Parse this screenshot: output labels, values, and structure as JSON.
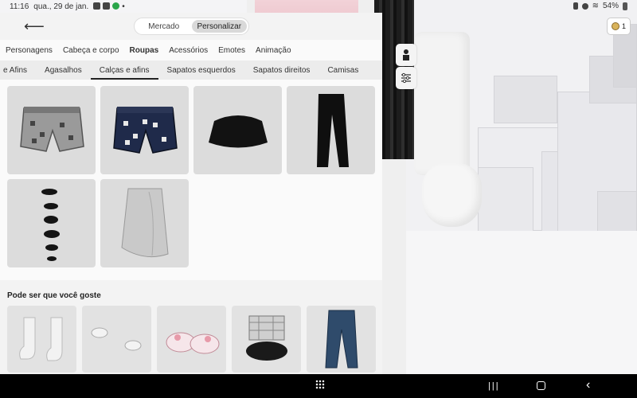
{
  "status_bar": {
    "time": "11:16",
    "date": "qua., 29 de jan.",
    "dot": "•",
    "battery": "54%"
  },
  "header": {
    "back_icon": "arrow-left-icon",
    "segments": [
      "Mercado",
      "Personalizar"
    ],
    "active_segment": 1
  },
  "categories": {
    "items": [
      "Personagens",
      "Cabeça e corpo",
      "Roupas",
      "Acessórios",
      "Emotes",
      "Animação"
    ],
    "active": 2
  },
  "subcategories": {
    "items": [
      "e Afins",
      "Agasalhos",
      "Calças e afins",
      "Sapatos esquerdos",
      "Sapatos direitos",
      "Camisas"
    ],
    "active": 2
  },
  "items": [
    {
      "name": "gray-patterned-shorts"
    },
    {
      "name": "navy-patterned-shorts"
    },
    {
      "name": "black-skirt"
    },
    {
      "name": "black-pants"
    },
    {
      "name": "spike-accessories"
    },
    {
      "name": "white-ruffle-skirt"
    }
  ],
  "suggestions": {
    "title": "Pode ser que você goste",
    "items": [
      "white-boots",
      "white-shoes",
      "pink-bunny-slippers",
      "plaid-shoes",
      "blue-jeans"
    ]
  },
  "robux": {
    "amount": "1"
  },
  "colors": {
    "panel": "#f3f3f3",
    "tile": "#dcdcdc",
    "nav": "#000000"
  }
}
